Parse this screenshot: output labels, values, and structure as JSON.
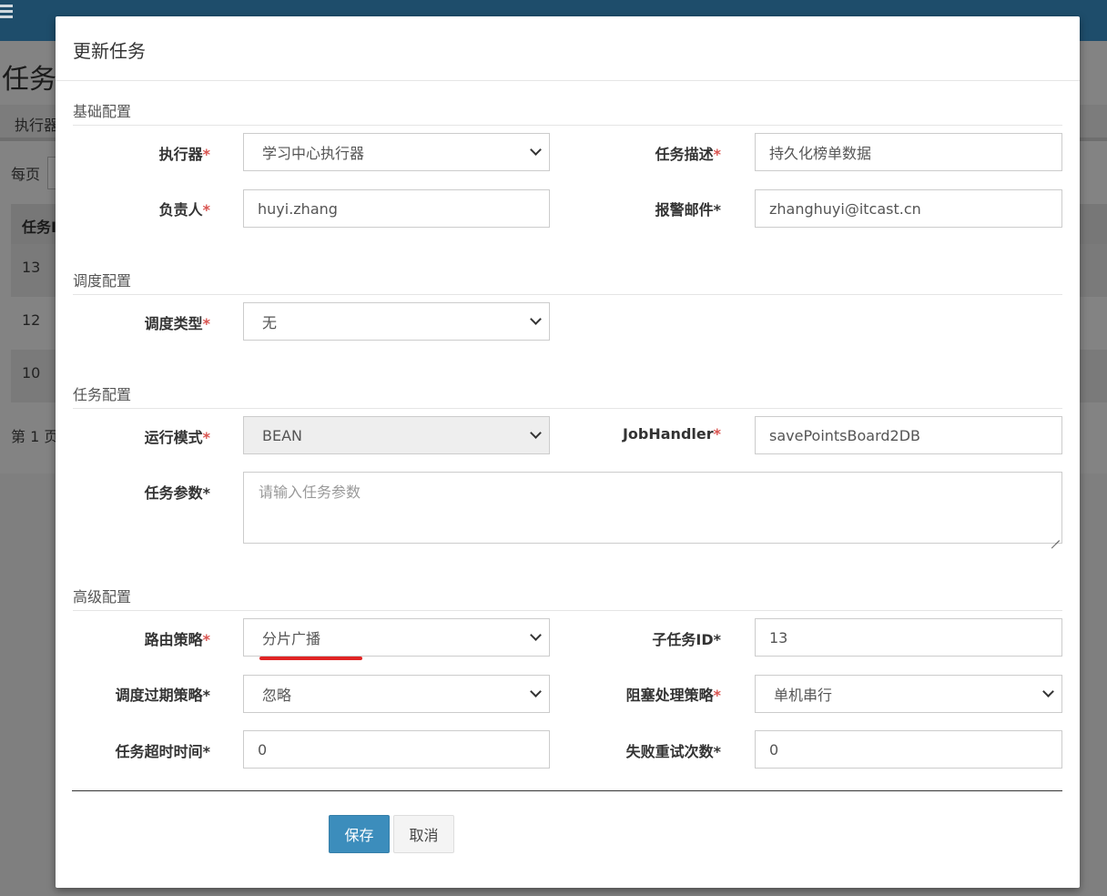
{
  "background": {
    "page_title": "任务",
    "filter_label": "执行器",
    "per_page_label": "每页",
    "table_header": "任务I",
    "rows": [
      "13",
      "12",
      "10"
    ],
    "pager_text": "第 1 页"
  },
  "modal": {
    "title": "更新任务",
    "sections": {
      "basic": "基础配置",
      "schedule": "调度配置",
      "task": "任务配置",
      "advanced": "高级配置"
    },
    "fields": {
      "executor": {
        "label": "执行器",
        "value": "学习中心执行器"
      },
      "task_desc": {
        "label": "任务描述",
        "value": "持久化榜单数据"
      },
      "owner": {
        "label": "负责人",
        "value": "huyi.zhang"
      },
      "alarm_email": {
        "label": "报警邮件",
        "value": "zhanghuyi@itcast.cn"
      },
      "schedule_type": {
        "label": "调度类型",
        "value": "无"
      },
      "run_mode": {
        "label": "运行模式",
        "value": "BEAN"
      },
      "job_handler": {
        "label": "JobHandler",
        "value": "savePointsBoard2DB"
      },
      "task_param": {
        "label": "任务参数",
        "placeholder": "请输入任务参数"
      },
      "route_strategy": {
        "label": "路由策略",
        "value": "分片广播"
      },
      "child_job_id": {
        "label": "子任务ID",
        "value": "13"
      },
      "misfire_strategy": {
        "label": "调度过期策略",
        "value": "忽略"
      },
      "block_strategy": {
        "label": "阻塞处理策略",
        "value": "单机串行"
      },
      "timeout": {
        "label": "任务超时时间",
        "value": "0"
      },
      "retry_count": {
        "label": "失败重试次数",
        "value": "0"
      }
    },
    "required_mark": "*",
    "buttons": {
      "save": "保存",
      "cancel": "取消"
    }
  },
  "colors": {
    "primary": "#3c8dbc",
    "required": "#d9534f",
    "annotation": "#e02424",
    "topbar": "#1e4d6b"
  }
}
